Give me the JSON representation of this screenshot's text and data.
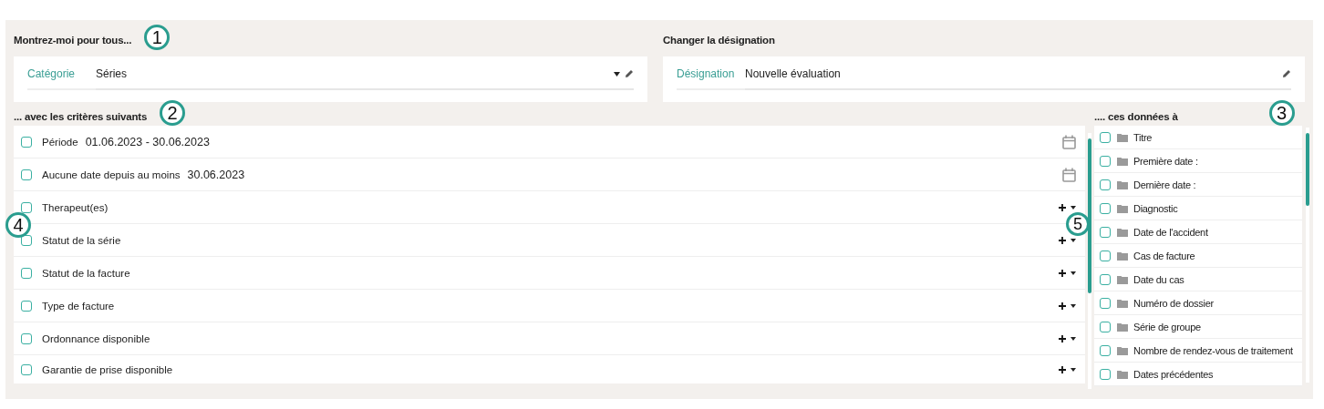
{
  "show_for_all": {
    "title": "Montrez-moi pour tous...",
    "callout": "1",
    "field": {
      "label": "Catégorie",
      "value": "Séries"
    }
  },
  "rename": {
    "title": "Changer la désignation",
    "field": {
      "label": "Désignation",
      "value": "Nouvelle évaluation"
    }
  },
  "criteria": {
    "title": "... avec les critères suivants",
    "callout": "2",
    "list_callout": "4",
    "rows": [
      {
        "kind": "date",
        "label": "Période",
        "value": "01.06.2023 - 30.06.2023",
        "checked": false
      },
      {
        "kind": "date",
        "label": "Aucune date depuis au moins",
        "value": "30.06.2023",
        "checked": false
      },
      {
        "kind": "multi",
        "label": "Therapeut(es)",
        "checked": false
      },
      {
        "kind": "multi",
        "label": "Statut de la série",
        "checked": false
      },
      {
        "kind": "multi",
        "label": "Statut de la facture",
        "checked": false
      },
      {
        "kind": "multi",
        "label": "Type de facture",
        "checked": false
      },
      {
        "kind": "multi",
        "label": "Ordonnance disponible",
        "checked": false
      },
      {
        "kind": "multi",
        "label": "Garantie de prise disponible",
        "checked": false
      }
    ]
  },
  "data_fields": {
    "title": ".... ces données à",
    "callout": "3",
    "list_callout": "5",
    "items": [
      {
        "label": "Titre",
        "checked": false
      },
      {
        "label": "Première date :",
        "checked": false
      },
      {
        "label": "Dernière date :",
        "checked": false
      },
      {
        "label": "Diagnostic",
        "checked": false
      },
      {
        "label": "Date de l'accident",
        "checked": false
      },
      {
        "label": "Cas de facture",
        "checked": false
      },
      {
        "label": "Date du cas",
        "checked": false
      },
      {
        "label": "Numéro de dossier",
        "checked": false
      },
      {
        "label": "Série de groupe",
        "checked": false
      },
      {
        "label": "Nombre de rendez-vous de traitement",
        "checked": false
      },
      {
        "label": "Dates précédentes",
        "checked": false
      }
    ]
  }
}
